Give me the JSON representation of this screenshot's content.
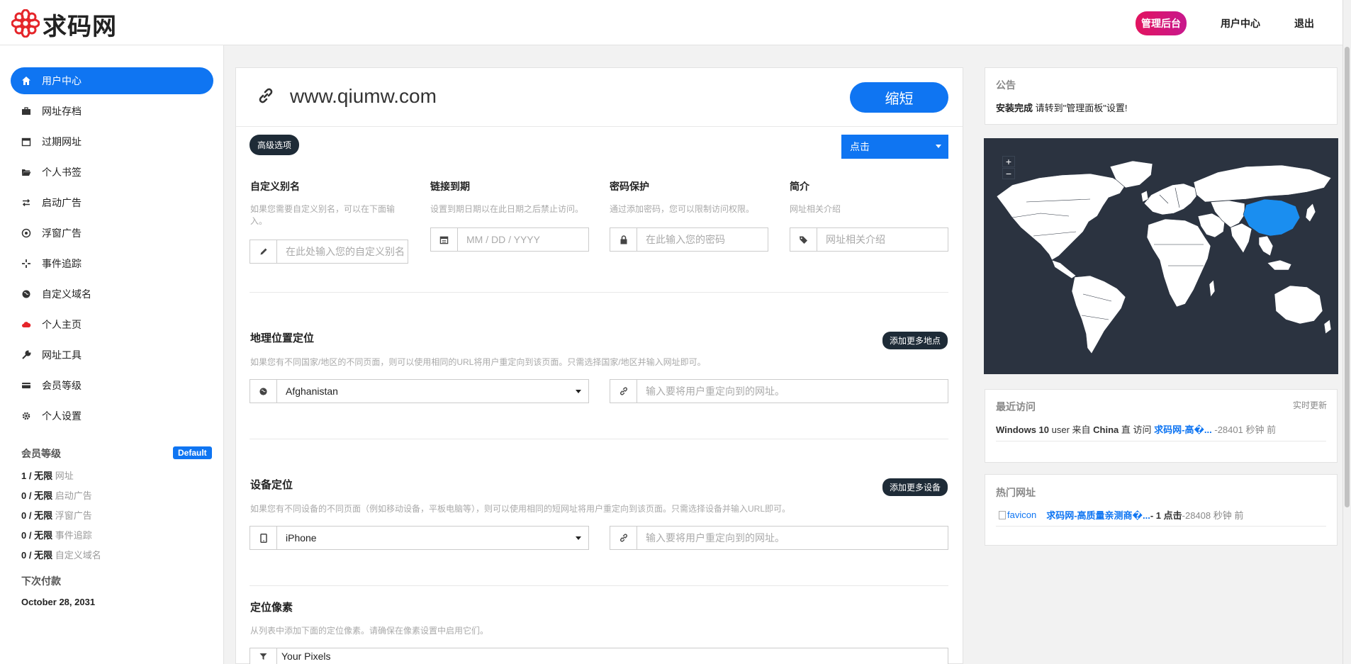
{
  "brand": {
    "name": "求码网",
    "logo_icon": "flower-logo-icon",
    "color": "#e5252a"
  },
  "topnav": {
    "admin": "管理后台",
    "user_center": "用户中心",
    "logout": "退出"
  },
  "sidebar": {
    "items": [
      {
        "label": "用户中心",
        "icon": "home-icon"
      },
      {
        "label": "网址存档",
        "icon": "briefcase-icon"
      },
      {
        "label": "过期网址",
        "icon": "calendar-icon"
      },
      {
        "label": "个人书签",
        "icon": "folder-open-icon"
      },
      {
        "label": "启动广告",
        "icon": "exchange-icon"
      },
      {
        "label": "浮窗广告",
        "icon": "dot-circle-icon"
      },
      {
        "label": "事件追踪",
        "icon": "crosshair-icon"
      },
      {
        "label": "自定义域名",
        "icon": "globe-icon"
      },
      {
        "label": "个人主页",
        "icon": "cloud-icon"
      },
      {
        "label": "网址工具",
        "icon": "wrench-icon"
      },
      {
        "label": "会员等级",
        "icon": "credit-card-icon"
      },
      {
        "label": "个人设置",
        "icon": "gear-icon"
      }
    ],
    "membership_title": "会员等级",
    "membership_badge": "Default",
    "limits": [
      {
        "count": "1 / 无限",
        "label": "网址"
      },
      {
        "count": "0 / 无限",
        "label": "启动广告"
      },
      {
        "count": "0 / 无限",
        "label": "浮窗广告"
      },
      {
        "count": "0 / 无限",
        "label": "事件追踪"
      },
      {
        "count": "0 / 无限",
        "label": "自定义域名"
      }
    ],
    "next_payment_title": "下次付款",
    "next_payment_date": "October 28, 2031"
  },
  "main": {
    "url_value": "www.qiumw.com",
    "shorten_label": "缩短",
    "advanced_label": "高级选项",
    "redirect_select": "点击",
    "fields": {
      "alias": {
        "label": "自定义别名",
        "help": "如果您需要自定义别名，可以在下面输入。",
        "placeholder": "在此处输入您的自定义别名"
      },
      "expiry": {
        "label": "链接到期",
        "help": "设置到期日期以在此日期之后禁止访问。",
        "placeholder": "MM / DD / YYYY"
      },
      "password": {
        "label": "密码保护",
        "help": "通过添加密码，您可以限制访问权限。",
        "placeholder": "在此输入您的密码"
      },
      "desc": {
        "label": "简介",
        "help": "网址相关介绍",
        "placeholder": "网址相关介绍"
      }
    },
    "geo": {
      "title": "地理位置定位",
      "add_label": "添加更多地点",
      "help": "如果您有不同国家/地区的不同页面，则可以使用相同的URL将用户重定向到该页面。只需选择国家/地区并输入网址即可。",
      "country": "Afghanistan",
      "url_placeholder": "输入要将用户重定向到的网址。"
    },
    "device": {
      "title": "设备定位",
      "add_label": "添加更多设备",
      "help": "如果您有不同设备的不同页面（例如移动设备，平板电脑等），则可以使用相同的短网址将用户重定向到该页面。只需选择设备并输入URL即可。",
      "device": "iPhone",
      "url_placeholder": "输入要将用户重定向到的网址。"
    },
    "pixels": {
      "title": "定位像素",
      "help": "从列表中添加下面的定位像素。请确保在像素设置中启用它们。",
      "value": "Your Pixels"
    }
  },
  "right": {
    "notice_title": "公告",
    "notice_strong": "安装完成",
    "notice_text": " 请转到\"管理面板\"设置!",
    "map": {
      "zoom_in": "+",
      "zoom_out": "−",
      "highlight_color": "#1a8ef0",
      "highlighted_country": "China"
    },
    "recent": {
      "title": "最近访问",
      "realtime": "实时更新",
      "os": "Windows 10",
      "user_from": " user 来自 ",
      "country": "China",
      "direct": " 直 访问 ",
      "link": "求码网-高�...",
      "time": " -28401 秒钟 前"
    },
    "hot": {
      "title": "热门网址",
      "favicon_alt": "favicon",
      "link": "求码网-高质量亲测商�...",
      "clicks": " - 1 点击",
      "time": " -28408 秒钟 前"
    }
  }
}
